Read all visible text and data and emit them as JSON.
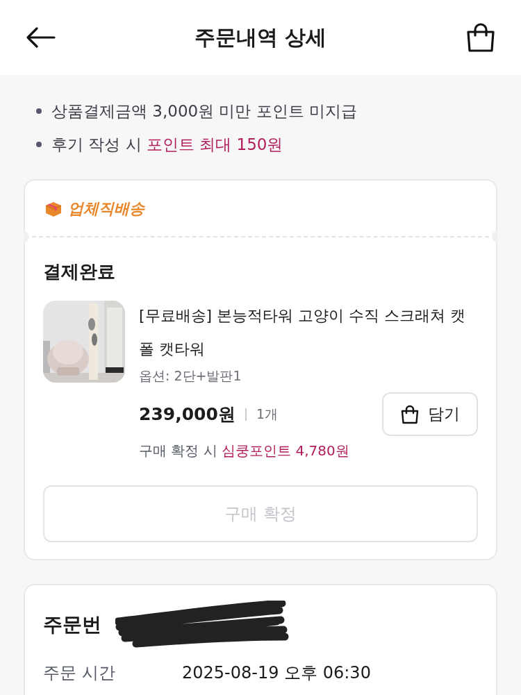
{
  "header": {
    "title": "주문내역 상세"
  },
  "notices": [
    {
      "text": "상품결제금액 3,000원 미만 포인트 미지급"
    },
    {
      "text": "후기 작성 시 ",
      "highlight": "포인트 최대 150원"
    }
  ],
  "order": {
    "shipping_label": "업체직배송",
    "status": "결제완료",
    "product": {
      "title": "[무료배송] 본능적타워 고양이 수직 스크래쳐 캣폴 캣타워",
      "option": "옵션: 2단+발판1",
      "price": "239,000원",
      "quantity": "1개"
    },
    "cart_button": "담기",
    "points": {
      "text": "구매 확정 시 ",
      "highlight": "심쿵포인트 4,780원"
    },
    "confirm_button": {
      "label": "구매 확정",
      "disabled": true
    }
  },
  "order_info": {
    "heading": "주문번",
    "rows": [
      {
        "label": "주문 시간",
        "value": "2025-08-19 오후 06:30"
      }
    ]
  }
}
